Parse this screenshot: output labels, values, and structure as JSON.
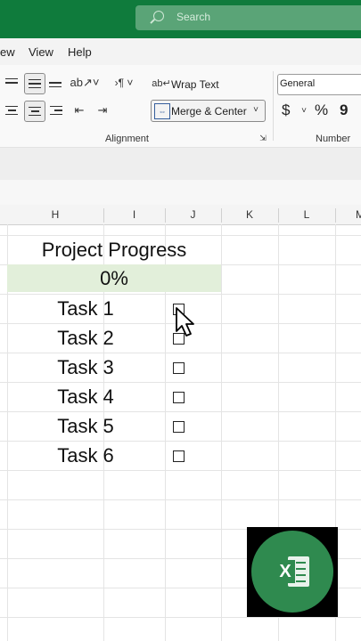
{
  "titlebar": {
    "search_placeholder": "Search"
  },
  "menu": {
    "items": [
      "ew",
      "View",
      "Help"
    ]
  },
  "ribbon": {
    "wrap_text_label": "Wrap Text",
    "merge_center_label": "Merge & Center",
    "alignment_group_label": "Alignment",
    "number_format_value": "General",
    "currency_symbol": "$",
    "percent_symbol": "%",
    "comma_symbol": "9",
    "number_group_label": "Number"
  },
  "columns": [
    "H",
    "I",
    "J",
    "K",
    "L",
    "M"
  ],
  "sheet": {
    "title": "Project Progress",
    "progress": "0%",
    "tasks": [
      "Task 1",
      "Task 2",
      "Task 3",
      "Task 4",
      "Task 5",
      "Task 6"
    ],
    "checkbox_glyph": "☐"
  },
  "colors": {
    "excel_green": "#0f7b3c",
    "progress_fill": "#e2efda"
  },
  "icons": [
    "search-icon",
    "align-top-icon",
    "align-middle-icon",
    "align-bottom-icon",
    "orientation-icon",
    "text-direction-icon",
    "wrap-text-icon",
    "align-left-icon",
    "align-center-icon",
    "align-right-icon",
    "decrease-indent-icon",
    "increase-indent-icon",
    "merge-center-icon",
    "chevron-down-icon",
    "dialog-launcher-icon",
    "mouse-cursor-icon",
    "excel-logo-icon"
  ]
}
